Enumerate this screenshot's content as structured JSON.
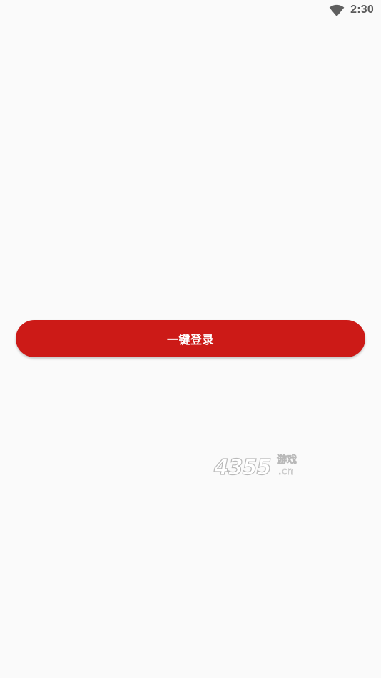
{
  "status_bar": {
    "time": "2:30",
    "wifi_icon": "wifi-icon",
    "text_color": "#5f5f5f"
  },
  "login": {
    "button_label": "一键登录",
    "button_color": "#cc1a17",
    "label_color": "#ffffff"
  },
  "watermark": {
    "numbers": "4355",
    "chars": "游戏",
    "domain": ".cn"
  }
}
